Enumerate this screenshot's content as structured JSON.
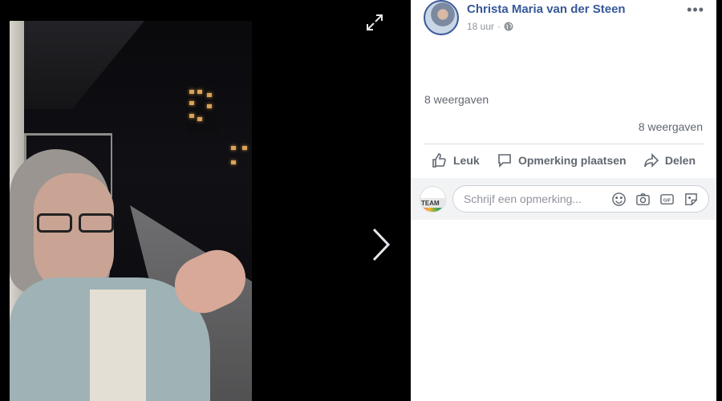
{
  "post": {
    "author": "Christa Maria van der Steen",
    "time": "18 uur",
    "views_short": "8 weergaven",
    "views_count": "8 weergaven"
  },
  "actions": {
    "like": "Leuk",
    "comment": "Opmerking plaatsen",
    "share": "Delen"
  },
  "comment_box": {
    "placeholder": "Schrijf een opmerking...",
    "avatar_text": "TEAM"
  },
  "icons": {
    "expand": "expand-icon",
    "next": "chevron-right-icon",
    "globe": "globe-icon",
    "more": "more-options-icon",
    "emoji": "emoji-icon",
    "camera": "camera-icon",
    "gif": "gif-icon",
    "sticker": "sticker-icon"
  },
  "colors": {
    "link": "#365899",
    "muted": "#606770",
    "meta": "#90949c"
  }
}
